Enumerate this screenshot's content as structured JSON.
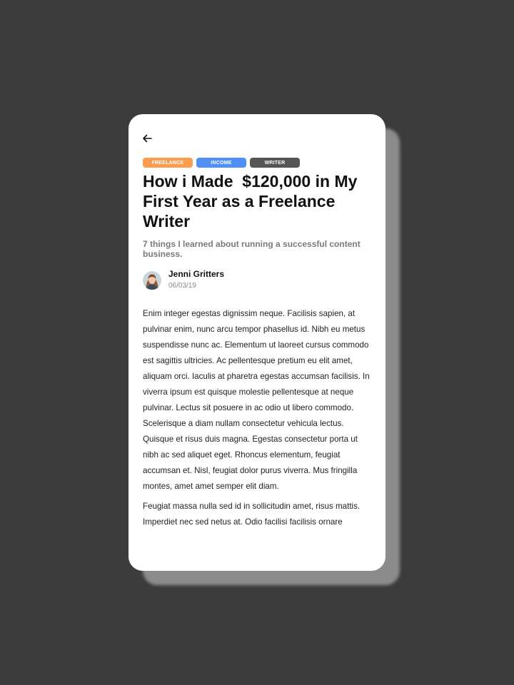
{
  "article": {
    "back_icon": "arrow-left-icon",
    "tags": [
      {
        "label": "FREELANCE",
        "color": "#fb9c4f"
      },
      {
        "label": "INCOME",
        "color": "#4f8ff7"
      },
      {
        "label": "WRITER",
        "color": "#555555"
      }
    ],
    "title": "How i Made  $120,000 in My First Year as a Freelance Writer",
    "subtitle": "7 things I learned about running a successful content business.",
    "author": {
      "name": "Jenni Gritters",
      "date": "06/03/19",
      "avatar_icon": "avatar-photo"
    },
    "paragraphs": [
      "Enim integer egestas dignissim neque. Facilisis sapien, at pulvinar enim, nunc arcu tempor phasellus id. Nibh eu metus suspendisse nunc ac. Elementum ut laoreet cursus commodo est sagittis ultricies. Ac pellentesque pretium eu elit amet, aliquam orci. Iaculis at pharetra egestas accumsan facilisis. In viverra ipsum est quisque molestie pellentesque at neque pulvinar. Lectus sit posuere in ac odio ut libero commodo. Scelerisque a diam nullam consectetur vehicula lectus. Quisque et risus duis magna. Egestas consectetur porta ut nibh ac sed aliquet eget. Rhoncus elementum, feugiat accumsan et. Nisl, feugiat dolor purus viverra. Mus fringilla montes, amet amet semper elit diam.",
      "Feugiat massa nulla sed id in sollicitudin amet, risus mattis. Imperdiet nec sed netus at. Odio facilisi facilisis ornare"
    ]
  },
  "colors": {
    "background": "#3c3c3c",
    "card": "#ffffff",
    "shadow": "#8c8c8c"
  }
}
